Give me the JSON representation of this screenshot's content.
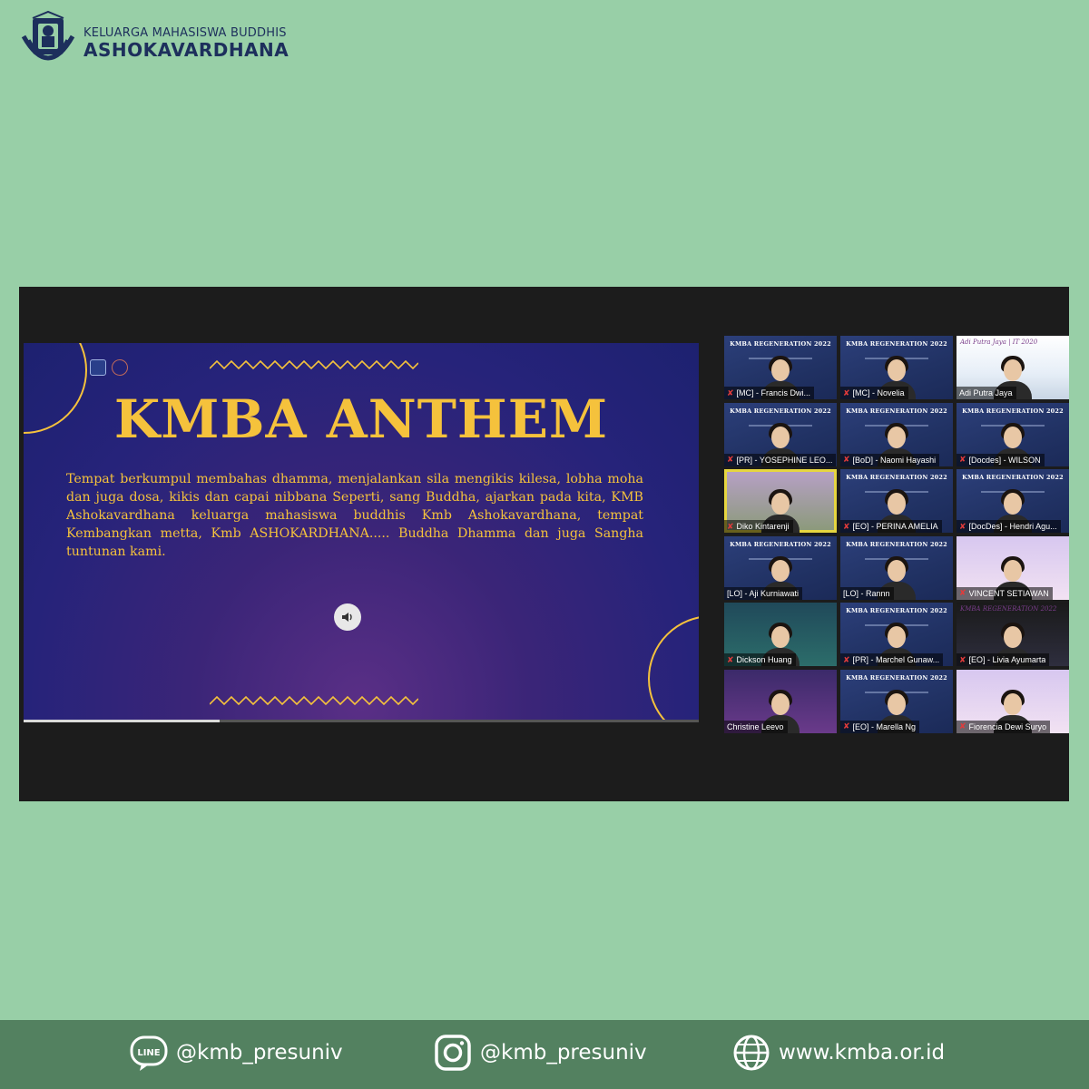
{
  "brand": {
    "sub": "KELUARGA MAHASISWA BUDDHIS",
    "main": "ASHOKAVARDHANA"
  },
  "slide": {
    "title": "KMBA ANTHEM",
    "body": "Tempat berkumpul membahas dhamma, menjalankan sila mengikis kilesa, lobha moha dan juga dosa, kikis dan capai nibbana Seperti, sang Buddha, ajarkan pada kita, KMB Ashokavardhana keluarga mahasiswa buddhis Kmb Ashokavardhana, tempat Kembangkan metta, Kmb ASHOKARDHANA.....  Buddha Dhamma dan juga Sangha tuntunan kami.",
    "audio_icon": "speaker-icon",
    "playback_progress": 0.29
  },
  "participants": [
    {
      "name": "[MC] - Francis Dwi...",
      "heading": "KMBA REGENERATION 2022",
      "muted": true,
      "style": ""
    },
    {
      "name": "[MC] - Novelia",
      "heading": "KMBA REGENERATION 2022",
      "muted": true,
      "style": ""
    },
    {
      "name": "Adi Putra Jaya",
      "heading": "Adi Putra Jaya | IT 2020",
      "muted": false,
      "style": "alt"
    },
    {
      "name": "[PR] - YOSEPHINE LEO...",
      "heading": "KMBA REGENERATION 2022",
      "muted": true,
      "style": ""
    },
    {
      "name": "[BoD] - Naomi Hayashi",
      "heading": "KMBA REGENERATION 2022",
      "muted": true,
      "style": ""
    },
    {
      "name": "[Docdes] - WILSON",
      "heading": "KMBA REGENERATION 2022",
      "muted": true,
      "style": ""
    },
    {
      "name": "Diko Kintarenji",
      "heading": "",
      "muted": true,
      "style": "alt6 active"
    },
    {
      "name": "[EO] - PERINA AMELIA",
      "heading": "KMBA REGENERATION 2022",
      "muted": true,
      "style": ""
    },
    {
      "name": "[DocDes] - Hendri Agu...",
      "heading": "KMBA REGENERATION 2022",
      "muted": true,
      "style": ""
    },
    {
      "name": "[LO] - Aji Kurniawati",
      "heading": "KMBA REGENERATION 2022",
      "muted": false,
      "style": ""
    },
    {
      "name": "[LO] - Rannn",
      "heading": "KMBA REGENERATION 2022",
      "muted": false,
      "style": ""
    },
    {
      "name": "VINCENT SETIAWAN",
      "heading": "",
      "muted": true,
      "style": "alt2"
    },
    {
      "name": "Dickson Huang",
      "heading": "",
      "muted": true,
      "style": "alt4"
    },
    {
      "name": "[PR] - Marchel Gunaw...",
      "heading": "KMBA REGENERATION 2022",
      "muted": true,
      "style": ""
    },
    {
      "name": "[EO] - Livia Ayumarta",
      "heading": "KMBA REGENERATION 2022",
      "muted": true,
      "style": "alt5"
    },
    {
      "name": "Christine Leevo",
      "heading": "",
      "muted": false,
      "style": "alt3"
    },
    {
      "name": "[EO] - Marella Ng",
      "heading": "KMBA REGENERATION 2022",
      "muted": true,
      "style": ""
    },
    {
      "name": "Fiorencia Dewi Suryo",
      "heading": "",
      "muted": true,
      "style": "alt2"
    }
  ],
  "footer": {
    "line": {
      "icon": "line-icon",
      "text": "@kmb_presuniv"
    },
    "instagram": {
      "icon": "instagram-icon",
      "text": "@kmb_presuniv"
    },
    "web": {
      "icon": "globe-icon",
      "text": "www.kmba.or.id"
    }
  },
  "colors": {
    "background": "#98cfa7",
    "footer": "#538160",
    "brand_navy": "#1d2f5c",
    "slide_gold": "#f5c23c"
  }
}
